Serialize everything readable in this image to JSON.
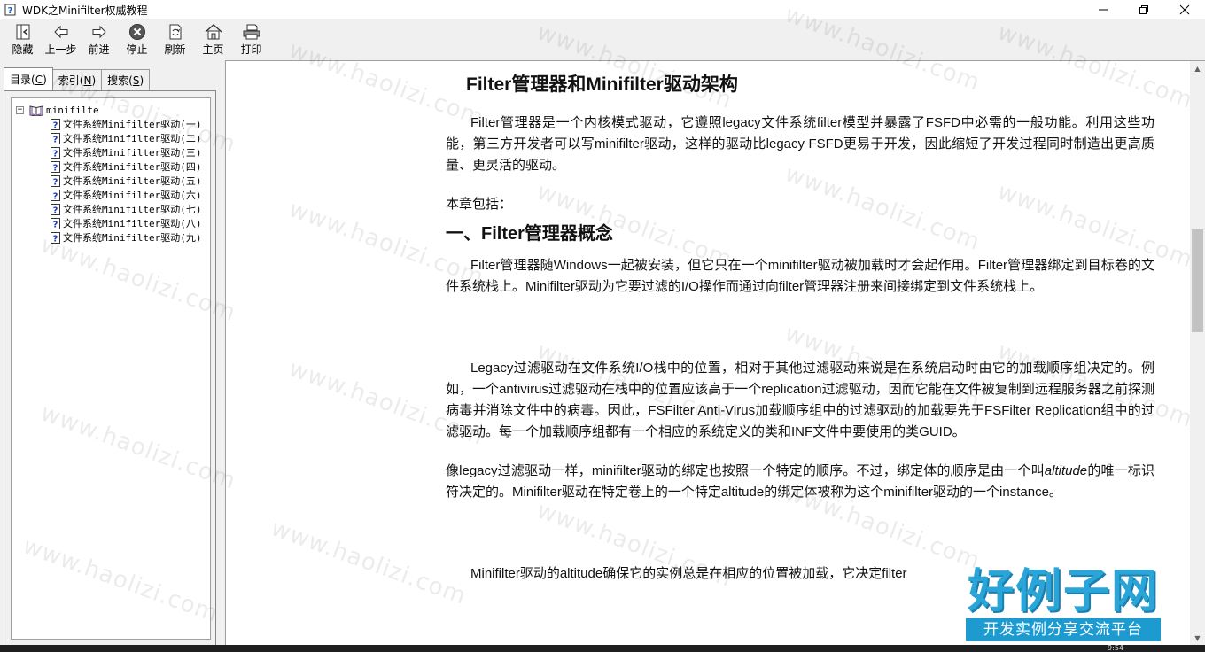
{
  "window": {
    "title": "WDK之Minifilter权威教程"
  },
  "toolbar": {
    "buttons": [
      {
        "label": "隐藏",
        "icon": "hide-icon"
      },
      {
        "label": "上一步",
        "icon": "back-arrow-icon"
      },
      {
        "label": "前进",
        "icon": "forward-arrow-icon"
      },
      {
        "label": "停止",
        "icon": "stop-icon"
      },
      {
        "label": "刷新",
        "icon": "refresh-icon"
      },
      {
        "label": "主页",
        "icon": "home-icon"
      },
      {
        "label": "打印",
        "icon": "print-icon"
      }
    ]
  },
  "tabs": [
    {
      "label": "目录",
      "key": "C"
    },
    {
      "label": "索引",
      "key": "N"
    },
    {
      "label": "搜索",
      "key": "S"
    }
  ],
  "tree": {
    "expander": "−",
    "root": "minifilte",
    "items": [
      "文件系统Minifilter驱动(一)",
      "文件系统Minifilter驱动(二)",
      "文件系统Minifilter驱动(三)",
      "文件系统Minifilter驱动(四)",
      "文件系统Minifilter驱动(五)",
      "文件系统Minifilter驱动(六)",
      "文件系统Minifilter驱动(七)",
      "文件系统Minifilter驱动(八)",
      "文件系统Minifilter驱动(九)"
    ]
  },
  "article": {
    "title": "Filter管理器和Minifilter驱动架构",
    "p1": "Filter管理器是一个内核模式驱动，它遵照legacy文件系统filter模型并暴露了FSFD中必需的一般功能。利用这些功能，第三方开发者可以写minifilter驱动，这样的驱动比legacy FSFD更易于开发，因此缩短了开发过程同时制造出更高质量、更灵活的驱动。",
    "p2": "本章包括：",
    "h2": "一、Filter管理器概念",
    "p3": "Filter管理器随Windows一起被安装，但它只在一个minifilter驱动被加载时才会起作用。Filter管理器绑定到目标卷的文件系统栈上。Minifilter驱动为它要过滤的I/O操作而通过向filter管理器注册来间接绑定到文件系统栈上。",
    "p4": "Legacy过滤驱动在文件系统I/O栈中的位置，相对于其他过滤驱动来说是在系统启动时由它的加载顺序组决定的。例如，一个antivirus过滤驱动在栈中的位置应该高于一个replication过滤驱动，因而它能在文件被复制到远程服务器之前探测病毒并消除文件中的病毒。因此，FSFilter Anti-Virus加载顺序组中的过滤驱动的加载要先于FSFilter Replication组中的过滤驱动。每一个加载顺序组都有一个相应的系统定义的类和INF文件中要使用的类GUID。",
    "p5_a": "像legacy过滤驱动一样，minifilter驱动的绑定也按照一个特定的顺序。不过，绑定体的顺序是由一个叫",
    "p5_em": "altitude",
    "p5_b": "的唯一标识符决定的。Minifilter驱动在特定卷上的一个特定altitude的绑定体被称为这个minifilter驱动的一个instance。",
    "p6": "Minifilter驱动的altitude确保它的实例总是在相应的位置被加载，它决定filter"
  },
  "watermark": "www.haolizi.com",
  "brand": {
    "name": "好例子网",
    "slogan": "开发实例分享交流平台"
  },
  "taskbar": {
    "clock": "9:54"
  },
  "colors": {
    "brand": "#2aa5d8",
    "brand_dark": "#1d9bd1"
  }
}
